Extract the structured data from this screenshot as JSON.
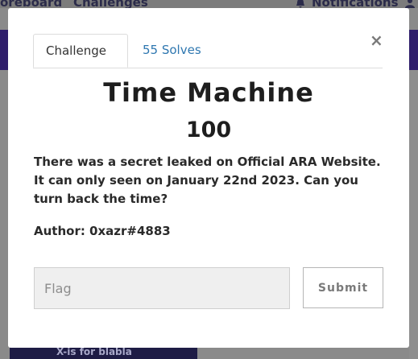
{
  "background": {
    "nav_left_text": "oreboard",
    "nav_challenges_text": "Challenges",
    "nav_notifications_text": "Notifications",
    "card_text": "X-is for blabla"
  },
  "modal": {
    "close_glyph": "×",
    "tabs": [
      {
        "label": "Challenge"
      },
      {
        "label": "55 Solves"
      }
    ],
    "name": "Time Machine",
    "value": "100",
    "description": "There was a secret leaked on Official ARA Website. It can only seen on January 22nd 2023. Can you turn back the time?",
    "author": "Author: 0xazr#4883",
    "flag_placeholder": "Flag",
    "submit_label": "Submit"
  },
  "icons": {
    "close": "close-icon",
    "bell": "bell-icon",
    "users": "users-icon"
  }
}
